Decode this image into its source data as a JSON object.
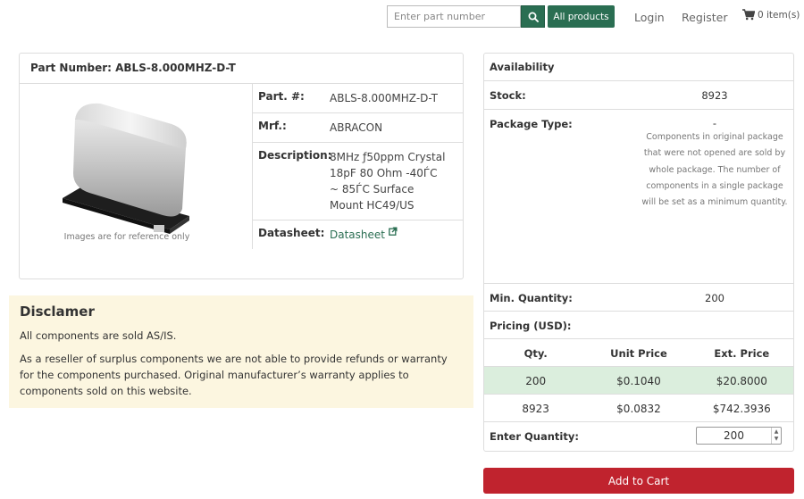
{
  "header": {
    "search_placeholder": "Enter part number",
    "search_icon": "search-icon",
    "all_products": "All products",
    "login": "Login",
    "register": "Register",
    "cart_label": "0 item(s)",
    "cart_icon": "cart-icon"
  },
  "product": {
    "title": "Part Number: ABLS-8.000MHZ-D-T",
    "image_caption": "Images are for reference only",
    "specs": [
      {
        "label": "Part. #:",
        "value": "ABLS-8.000MHZ-D-T"
      },
      {
        "label": "Mrf.:",
        "value": "ABRACON"
      },
      {
        "label": "Description:",
        "value": "8MHz ƒ50ppm Crystal 18pF 80 Ohm -40ЃC ~ 85ЃC Surface Mount HC49/US"
      },
      {
        "label": "Datasheet:",
        "value": "Datasheet"
      }
    ],
    "external_link_icon": "external-link-icon"
  },
  "disclaimer": {
    "title": "Disclamer",
    "p1": "All components are sold AS/IS.",
    "p2": "As a reseller of surplus components we are not able to provide refunds or warranty for the components purchased. Original manufacturer’s warranty applies to components sold on this website."
  },
  "availability": {
    "title": "Availability",
    "stock_label": "Stock:",
    "stock_value": "8923",
    "package_label": "Package Type:",
    "package_value": "-",
    "package_note": "Components in original package that were not opened are sold by whole package. The number of components in a single package will be set as a minimum quantity.",
    "min_qty_label": "Min. Quantity:",
    "min_qty_value": "200",
    "pricing_label": "Pricing (USD):",
    "pricing_headers": [
      "Qty.",
      "Unit Price",
      "Ext. Price"
    ],
    "pricing_rows": [
      {
        "qty": "200",
        "unit": "$0.1040",
        "ext": "$20.8000"
      },
      {
        "qty": "8923",
        "unit": "$0.0832",
        "ext": "$742.3936"
      }
    ],
    "enter_qty_label": "Enter Quantity:",
    "enter_qty_value": "200",
    "add_to_cart": "Add to Cart"
  },
  "colors": {
    "brand_green": "#2a6e52",
    "cart_red": "#c0232e",
    "highlight_row": "#dbeedd",
    "disclaimer_bg": "#fcf6e0"
  }
}
